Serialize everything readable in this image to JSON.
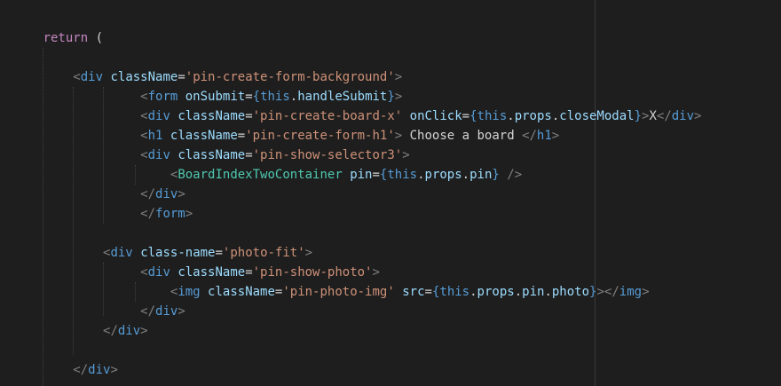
{
  "theme": {
    "background": "#1e1e1e",
    "keyword": "#c586c0",
    "tag": "#569cd6",
    "component": "#4ec9b0",
    "attribute": "#9cdcfe",
    "string": "#ce9178",
    "punctuation": "#808080",
    "text": "#d4d4d4"
  },
  "code_lines": [
    {
      "indent": 0,
      "tokens": []
    },
    {
      "indent": 6,
      "tokens": [
        {
          "t": "return",
          "c": "k"
        },
        {
          "t": " (",
          "c": "plain"
        }
      ]
    },
    {
      "indent": 0,
      "tokens": []
    },
    {
      "indent": 10,
      "tokens": [
        {
          "t": "<",
          "c": "punct"
        },
        {
          "t": "div",
          "c": "tag"
        },
        {
          "t": " ",
          "c": "plain"
        },
        {
          "t": "className",
          "c": "attr"
        },
        {
          "t": "=",
          "c": "plain"
        },
        {
          "t": "'pin-create-form-background'",
          "c": "str"
        },
        {
          "t": ">",
          "c": "punct"
        }
      ]
    },
    {
      "indent": 19,
      "tokens": [
        {
          "t": "<",
          "c": "punct"
        },
        {
          "t": "form",
          "c": "tag"
        },
        {
          "t": " ",
          "c": "plain"
        },
        {
          "t": "onSubmit",
          "c": "attr"
        },
        {
          "t": "=",
          "c": "plain"
        },
        {
          "t": "{",
          "c": "br"
        },
        {
          "t": "this",
          "c": "tag"
        },
        {
          "t": ".",
          "c": "plain"
        },
        {
          "t": "handleSubmit",
          "c": "attr"
        },
        {
          "t": "}",
          "c": "br"
        },
        {
          "t": ">",
          "c": "punct"
        }
      ]
    },
    {
      "indent": 19,
      "tokens": [
        {
          "t": "<",
          "c": "punct"
        },
        {
          "t": "div",
          "c": "tag"
        },
        {
          "t": " ",
          "c": "plain"
        },
        {
          "t": "className",
          "c": "attr"
        },
        {
          "t": "=",
          "c": "plain"
        },
        {
          "t": "'pin-create-board-x'",
          "c": "str"
        },
        {
          "t": " ",
          "c": "plain"
        },
        {
          "t": "onClick",
          "c": "attr"
        },
        {
          "t": "=",
          "c": "plain"
        },
        {
          "t": "{",
          "c": "br"
        },
        {
          "t": "this",
          "c": "tag"
        },
        {
          "t": ".",
          "c": "plain"
        },
        {
          "t": "props",
          "c": "attr"
        },
        {
          "t": ".",
          "c": "plain"
        },
        {
          "t": "closeModal",
          "c": "attr"
        },
        {
          "t": "}",
          "c": "br"
        },
        {
          "t": ">",
          "c": "punct"
        },
        {
          "t": "X",
          "c": "plain"
        },
        {
          "t": "</",
          "c": "punct"
        },
        {
          "t": "div",
          "c": "tag"
        },
        {
          "t": ">",
          "c": "punct"
        }
      ]
    },
    {
      "indent": 19,
      "tokens": [
        {
          "t": "<",
          "c": "punct"
        },
        {
          "t": "h1",
          "c": "tag"
        },
        {
          "t": " ",
          "c": "plain"
        },
        {
          "t": "className",
          "c": "attr"
        },
        {
          "t": "=",
          "c": "plain"
        },
        {
          "t": "'pin-create-form-h1'",
          "c": "str"
        },
        {
          "t": ">",
          "c": "punct"
        },
        {
          "t": " Choose a board ",
          "c": "plain"
        },
        {
          "t": "</",
          "c": "punct"
        },
        {
          "t": "h1",
          "c": "tag"
        },
        {
          "t": ">",
          "c": "punct"
        }
      ]
    },
    {
      "indent": 19,
      "tokens": [
        {
          "t": "<",
          "c": "punct"
        },
        {
          "t": "div",
          "c": "tag"
        },
        {
          "t": " ",
          "c": "plain"
        },
        {
          "t": "className",
          "c": "attr"
        },
        {
          "t": "=",
          "c": "plain"
        },
        {
          "t": "'pin-show-selector3'",
          "c": "str"
        },
        {
          "t": ">",
          "c": "punct"
        }
      ]
    },
    {
      "indent": 23,
      "tokens": [
        {
          "t": "<",
          "c": "punct"
        },
        {
          "t": "BoardIndexTwoContainer",
          "c": "comp"
        },
        {
          "t": " ",
          "c": "plain"
        },
        {
          "t": "pin",
          "c": "attr"
        },
        {
          "t": "=",
          "c": "plain"
        },
        {
          "t": "{",
          "c": "br"
        },
        {
          "t": "this",
          "c": "tag"
        },
        {
          "t": ".",
          "c": "plain"
        },
        {
          "t": "props",
          "c": "attr"
        },
        {
          "t": ".",
          "c": "plain"
        },
        {
          "t": "pin",
          "c": "attr"
        },
        {
          "t": "}",
          "c": "br"
        },
        {
          "t": " />",
          "c": "punct"
        }
      ]
    },
    {
      "indent": 19,
      "tokens": [
        {
          "t": "</",
          "c": "punct"
        },
        {
          "t": "div",
          "c": "tag"
        },
        {
          "t": ">",
          "c": "punct"
        }
      ]
    },
    {
      "indent": 19,
      "tokens": [
        {
          "t": "</",
          "c": "punct"
        },
        {
          "t": "form",
          "c": "tag"
        },
        {
          "t": ">",
          "c": "punct"
        }
      ]
    },
    {
      "indent": 0,
      "tokens": []
    },
    {
      "indent": 14,
      "tokens": [
        {
          "t": "<",
          "c": "punct"
        },
        {
          "t": "div",
          "c": "tag"
        },
        {
          "t": " ",
          "c": "plain"
        },
        {
          "t": "class-name",
          "c": "attr"
        },
        {
          "t": "=",
          "c": "plain"
        },
        {
          "t": "'photo-fit'",
          "c": "str"
        },
        {
          "t": ">",
          "c": "punct"
        }
      ]
    },
    {
      "indent": 19,
      "tokens": [
        {
          "t": "<",
          "c": "punct"
        },
        {
          "t": "div",
          "c": "tag"
        },
        {
          "t": " ",
          "c": "plain"
        },
        {
          "t": "className",
          "c": "attr"
        },
        {
          "t": "=",
          "c": "plain"
        },
        {
          "t": "'pin-show-photo'",
          "c": "str"
        },
        {
          "t": ">",
          "c": "punct"
        }
      ]
    },
    {
      "indent": 23,
      "tokens": [
        {
          "t": "<",
          "c": "punct"
        },
        {
          "t": "img",
          "c": "tag"
        },
        {
          "t": " ",
          "c": "plain"
        },
        {
          "t": "className",
          "c": "attr"
        },
        {
          "t": "=",
          "c": "plain"
        },
        {
          "t": "'pin-photo-img'",
          "c": "str"
        },
        {
          "t": " ",
          "c": "plain"
        },
        {
          "t": "src",
          "c": "attr"
        },
        {
          "t": "=",
          "c": "plain"
        },
        {
          "t": "{",
          "c": "br"
        },
        {
          "t": "this",
          "c": "tag"
        },
        {
          "t": ".",
          "c": "plain"
        },
        {
          "t": "props",
          "c": "attr"
        },
        {
          "t": ".",
          "c": "plain"
        },
        {
          "t": "pin",
          "c": "attr"
        },
        {
          "t": ".",
          "c": "plain"
        },
        {
          "t": "photo",
          "c": "attr"
        },
        {
          "t": "}",
          "c": "br"
        },
        {
          "t": "></",
          "c": "punct"
        },
        {
          "t": "img",
          "c": "tag"
        },
        {
          "t": ">",
          "c": "punct"
        }
      ]
    },
    {
      "indent": 19,
      "tokens": [
        {
          "t": "</",
          "c": "punct"
        },
        {
          "t": "div",
          "c": "tag"
        },
        {
          "t": ">",
          "c": "punct"
        }
      ]
    },
    {
      "indent": 14,
      "tokens": [
        {
          "t": "</",
          "c": "punct"
        },
        {
          "t": "div",
          "c": "tag"
        },
        {
          "t": ">",
          "c": "punct"
        }
      ]
    },
    {
      "indent": 0,
      "tokens": []
    },
    {
      "indent": 10,
      "tokens": [
        {
          "t": "</",
          "c": "punct"
        },
        {
          "t": "div",
          "c": "tag"
        },
        {
          "t": ">",
          "c": "punct"
        }
      ]
    },
    {
      "indent": 0,
      "tokens": []
    }
  ]
}
